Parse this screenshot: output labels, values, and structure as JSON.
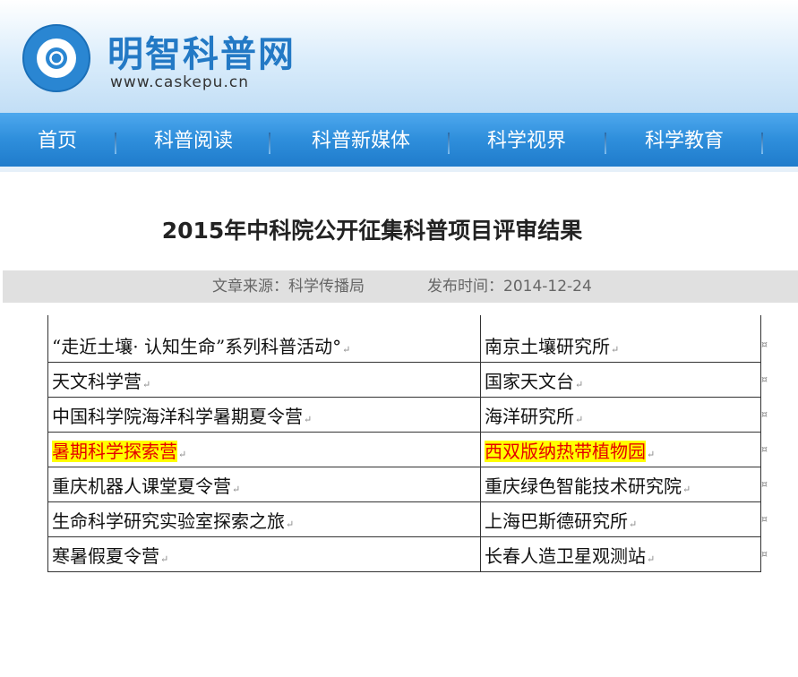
{
  "header": {
    "site_name": "明智科普网",
    "site_url": "www.caskepu.cn",
    "logo_icon": "cas-logo-icon"
  },
  "nav": {
    "items": [
      {
        "label": "首页"
      },
      {
        "label": "科普阅读"
      },
      {
        "label": "科普新媒体"
      },
      {
        "label": "科学视界"
      },
      {
        "label": "科学教育"
      }
    ]
  },
  "article": {
    "title": "2015年中科院公开征集科普项目评审结果",
    "source": "文章来源：科学传播局",
    "date": "发布时间：2014-12-24"
  },
  "table": {
    "rows": [
      {
        "project": "“走近土壤· 认知生命”系列科普活动°",
        "unit": "南京土壤研究所",
        "highlight": false
      },
      {
        "project": "天文科学营",
        "unit": "国家天文台",
        "highlight": false
      },
      {
        "project": "中国科学院海洋科学暑期夏令营",
        "unit": "海洋研究所",
        "highlight": false
      },
      {
        "project": "暑期科学探索营",
        "unit": "西双版纳热带植物园",
        "highlight": true
      },
      {
        "project": "重庆机器人课堂夏令营",
        "unit": "重庆绿色智能技术研究院",
        "highlight": false
      },
      {
        "project": "生命科学研究实验室探索之旅",
        "unit": "上海巴斯德研究所",
        "highlight": false
      },
      {
        "project": "寒暑假夏令营",
        "unit": "长春人造卫星观测站",
        "highlight": false
      }
    ],
    "paragraph_mark": "↵",
    "cell_end_mark": "¤",
    "highlight_bg": "#ffff00",
    "highlight_text": "#e60000"
  }
}
